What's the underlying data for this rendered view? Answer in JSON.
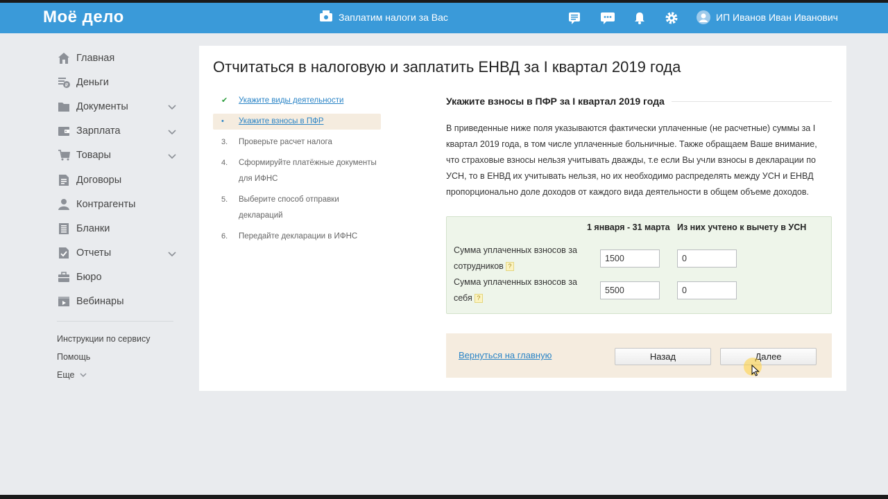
{
  "header": {
    "logo": "Моё дело",
    "promo_label": "Заплатим налоги за Вас",
    "user_name": "ИП Иванов Иван Иванович",
    "icons": [
      "chat-list-icon",
      "chat-bubble-icon",
      "bell-icon",
      "gear-icon"
    ]
  },
  "sidebar": {
    "items": [
      {
        "label": "Главная",
        "icon": "home-icon"
      },
      {
        "label": "Деньги",
        "icon": "money-icon"
      },
      {
        "label": "Документы",
        "icon": "folder-icon"
      },
      {
        "label": "Зарплата",
        "icon": "wallet-icon"
      },
      {
        "label": "Товары",
        "icon": "box-icon"
      },
      {
        "label": "Договоры",
        "icon": "contract-icon"
      },
      {
        "label": "Контрагенты",
        "icon": "person-icon"
      },
      {
        "label": "Бланки",
        "icon": "forms-icon"
      },
      {
        "label": "Отчеты",
        "icon": "report-icon"
      },
      {
        "label": "Бюро",
        "icon": "briefcase-icon"
      },
      {
        "label": "Вебинары",
        "icon": "video-icon"
      }
    ],
    "links": {
      "instructions": "Инструкции по сервису",
      "help": "Помощь",
      "more": "Еще"
    }
  },
  "page": {
    "title": "Отчитаться в налоговую и заплатить ЕНВД за I квартал 2019 года"
  },
  "steps": [
    {
      "mark": "✔",
      "label": "Укажите виды деятельности"
    },
    {
      "mark": "•",
      "label": "Укажите взносы в ПФР"
    },
    {
      "mark": "3.",
      "label": "Проверьте расчет налога"
    },
    {
      "mark": "4.",
      "label": "Сформируйте платёжные документы для ИФНС"
    },
    {
      "mark": "5.",
      "label": "Выберите способ отправки деклараций"
    },
    {
      "mark": "6.",
      "label": "Передайте декларации в ИФНС"
    }
  ],
  "section": {
    "title": "Укажите взносы в ПФР за I квартал 2019 года",
    "description": "В приведенные ниже поля указываются фактически уплаченные (не расчетные) суммы за I квартал 2019 года, в том числе уплаченные больничные. Также обращаем Ваше внимание, что страховые взносы нельзя учитывать дважды, т.е если Вы учли взносы в декларации по УСН, то в ЕНВД их учитывать нельзя, но их необходимо распределять между УСН и ЕНВД пропорционально доле доходов от каждого вида деятельности в общем объеме доходов."
  },
  "pfr_table": {
    "col_period": "1 января - 31 марта",
    "col_usn": "Из них учтено к вычету в УСН",
    "rows": [
      {
        "label_line1": "Сумма уплаченных взносов за",
        "label_line2": "сотрудников",
        "amount": "1500",
        "usn": "0"
      },
      {
        "label_line1": "Сумма уплаченных взносов за",
        "label_line2": "себя",
        "amount": "5500",
        "usn": "0"
      }
    ],
    "help_mark": "?"
  },
  "footer": {
    "back_home": "Вернуться на главную",
    "prev": "Назад",
    "next": "Далее"
  },
  "colors": {
    "header": "#3a9ad9",
    "link": "#2a84c6",
    "active_step": "#f5ecdf",
    "table_bg": "#eef5ea",
    "done_check": "#2e9e3e"
  }
}
